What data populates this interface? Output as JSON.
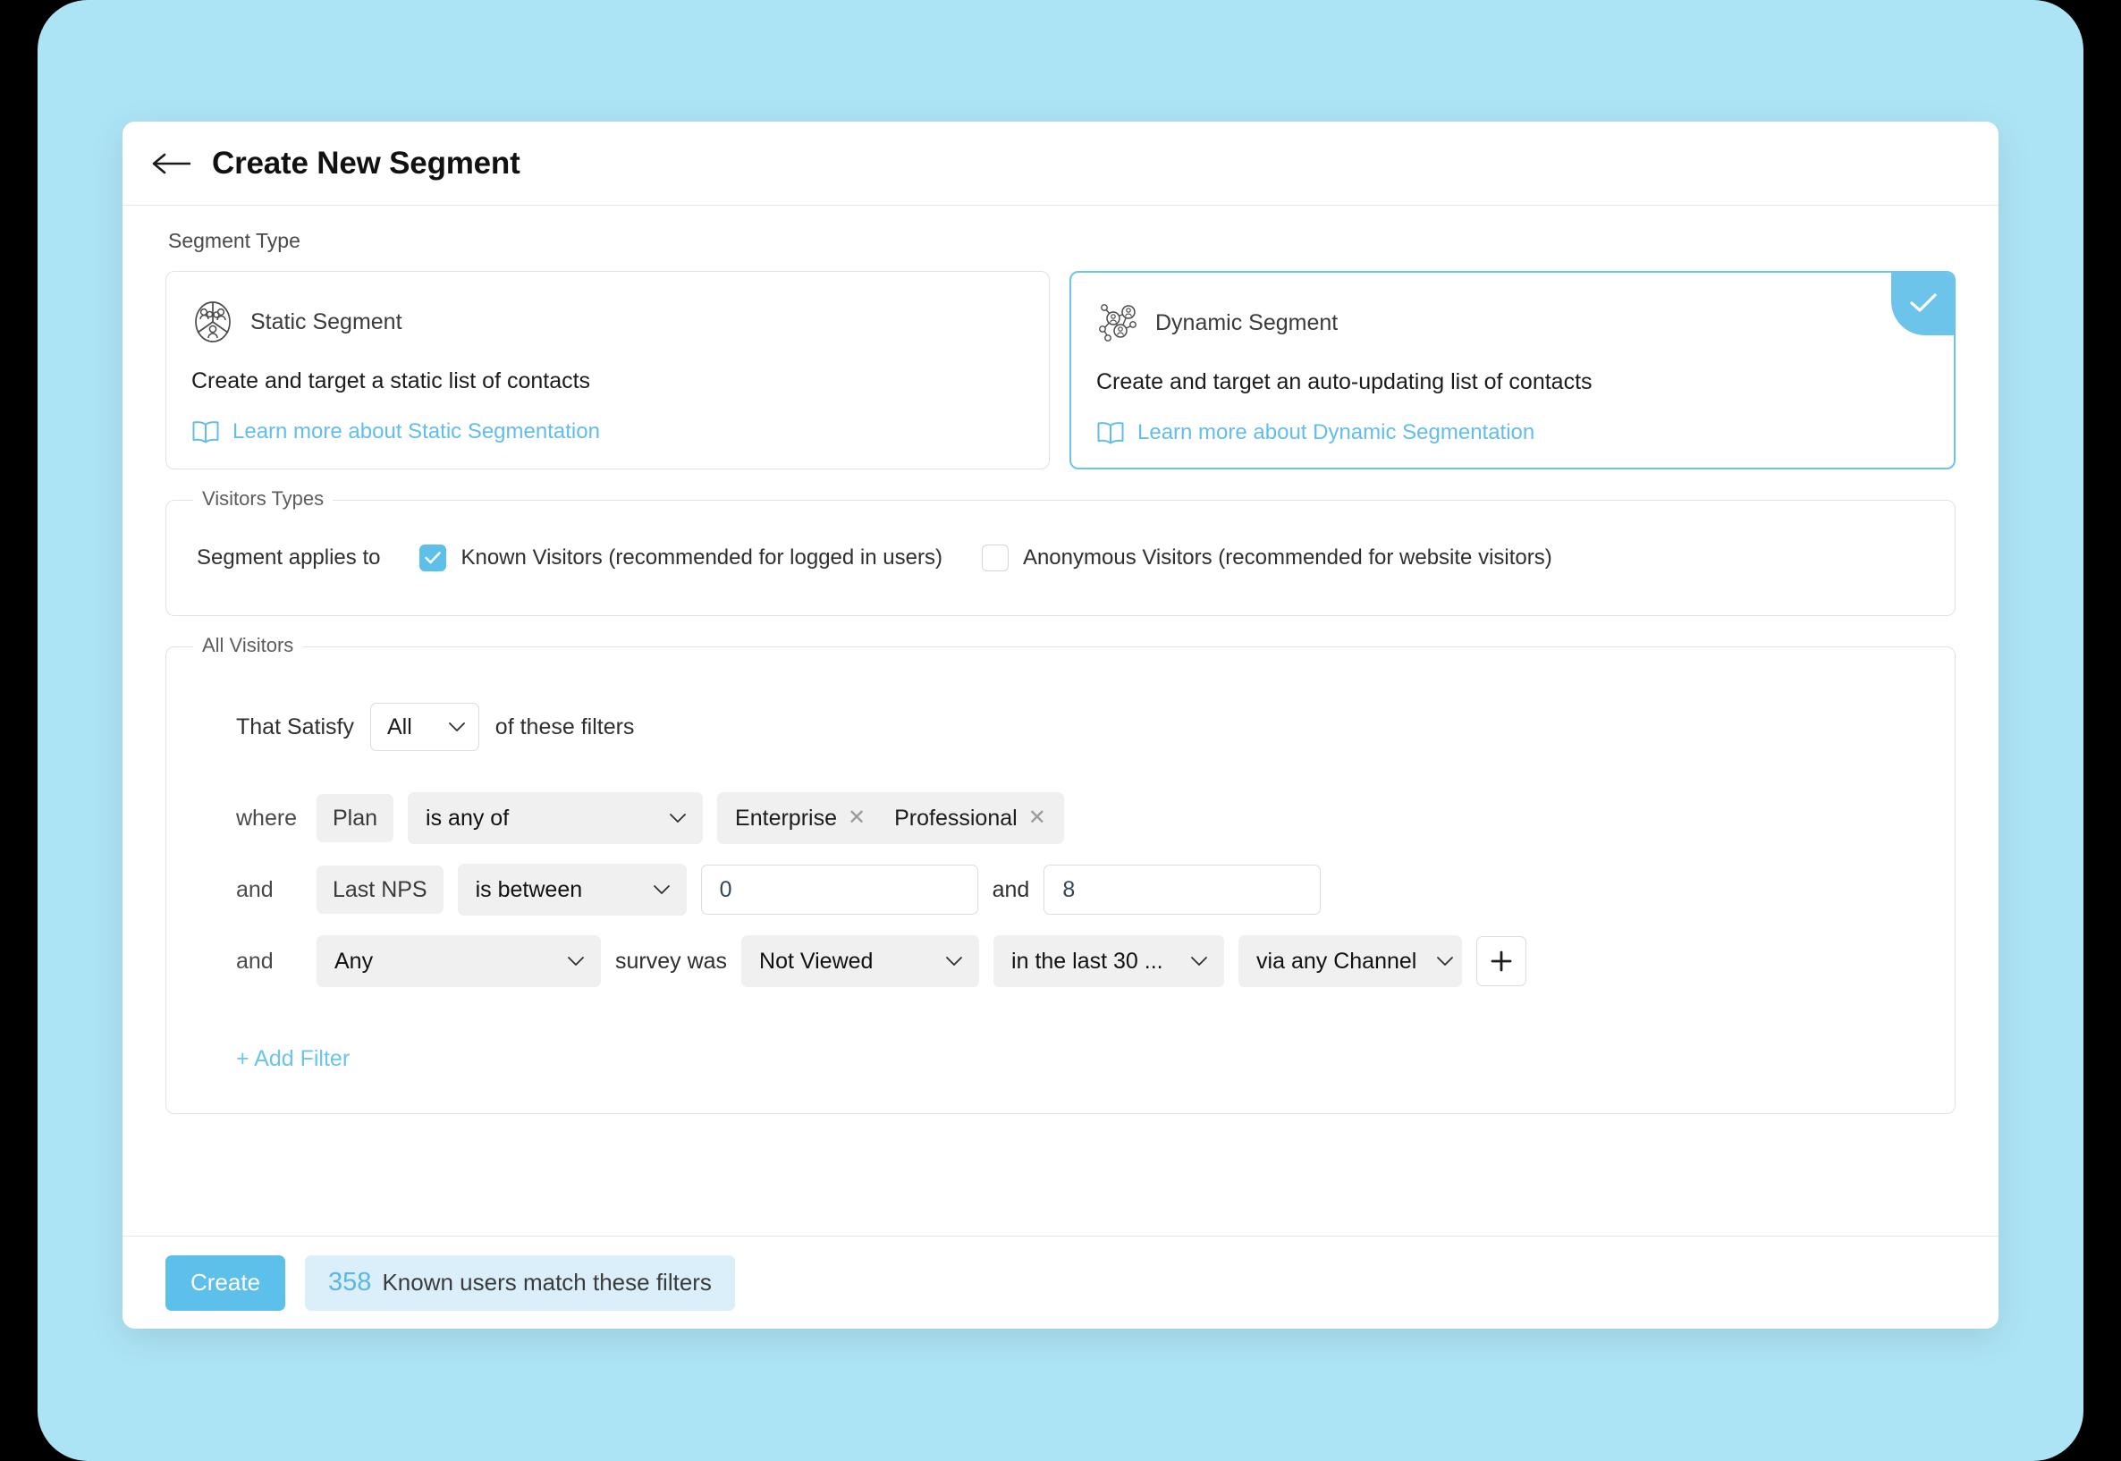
{
  "header": {
    "title": "Create New Segment",
    "back_icon": "arrow-left-icon"
  },
  "segment_type": {
    "label": "Segment Type",
    "cards": [
      {
        "icon": "static-segment-icon",
        "title": "Static Segment",
        "description": "Create and target a static list of contacts",
        "link_icon": "book-icon",
        "link_label": "Learn more about Static Segmentation",
        "selected": false
      },
      {
        "icon": "dynamic-segment-icon",
        "title": "Dynamic Segment",
        "description": "Create and target an auto-updating list of contacts",
        "link_icon": "book-icon",
        "link_label": "Learn more about Dynamic Segmentation",
        "selected": true
      }
    ]
  },
  "visitors_types": {
    "legend": "Visitors Types",
    "applies_to_label": "Segment applies to",
    "options": [
      {
        "label": "Known Visitors (recommended for logged in users)",
        "checked": true
      },
      {
        "label": "Anonymous Visitors (recommended for website visitors)",
        "checked": false
      }
    ]
  },
  "all_visitors": {
    "legend": "All Visitors",
    "satisfy_prefix": "That Satisfy",
    "satisfy_value": "All",
    "satisfy_suffix": "of these filters",
    "rows": [
      {
        "conjunction": "where",
        "field": "Plan",
        "operator": "is any of",
        "tags": [
          "Enterprise",
          "Professional"
        ]
      },
      {
        "conjunction": "and",
        "field": "Last NPS",
        "operator": "is between",
        "value_min": "0",
        "between_joiner": "and",
        "value_max": "8"
      },
      {
        "conjunction": "and",
        "survey_scope": "Any",
        "middle_label": "survey was",
        "survey_state": "Not Viewed",
        "timeframe": "in the last 30 ...",
        "channel": "via any Channel",
        "add_icon": "plus-icon"
      }
    ],
    "add_filter_label": "+ Add Filter"
  },
  "footer": {
    "create_label": "Create",
    "match_count": "358",
    "match_text": "Known users match these filters"
  },
  "colors": {
    "accent": "#5cc0ea",
    "link": "#6cc4ea",
    "backdrop": "#ade4f5",
    "chip_bg": "#dbeffa"
  }
}
